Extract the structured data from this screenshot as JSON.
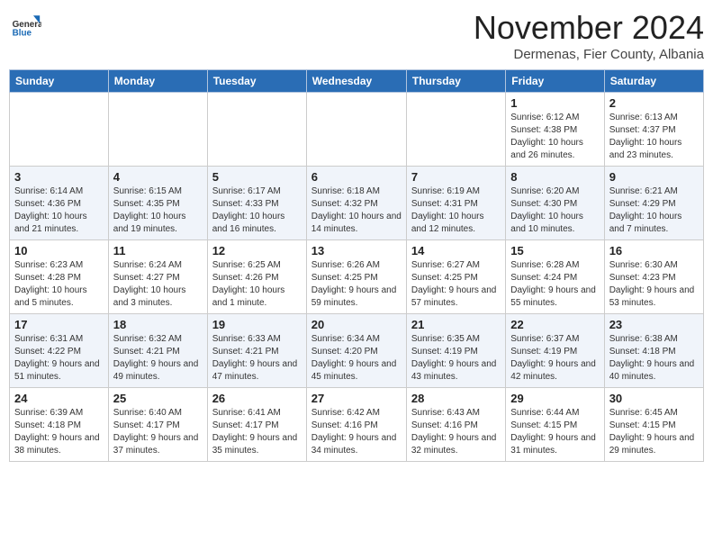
{
  "header": {
    "logo_line1": "General",
    "logo_line2": "Blue",
    "month": "November 2024",
    "location": "Dermenas, Fier County, Albania"
  },
  "weekdays": [
    "Sunday",
    "Monday",
    "Tuesday",
    "Wednesday",
    "Thursday",
    "Friday",
    "Saturday"
  ],
  "weeks": [
    [
      {
        "day": "",
        "info": ""
      },
      {
        "day": "",
        "info": ""
      },
      {
        "day": "",
        "info": ""
      },
      {
        "day": "",
        "info": ""
      },
      {
        "day": "",
        "info": ""
      },
      {
        "day": "1",
        "info": "Sunrise: 6:12 AM\nSunset: 4:38 PM\nDaylight: 10 hours and 26 minutes."
      },
      {
        "day": "2",
        "info": "Sunrise: 6:13 AM\nSunset: 4:37 PM\nDaylight: 10 hours and 23 minutes."
      }
    ],
    [
      {
        "day": "3",
        "info": "Sunrise: 6:14 AM\nSunset: 4:36 PM\nDaylight: 10 hours and 21 minutes."
      },
      {
        "day": "4",
        "info": "Sunrise: 6:15 AM\nSunset: 4:35 PM\nDaylight: 10 hours and 19 minutes."
      },
      {
        "day": "5",
        "info": "Sunrise: 6:17 AM\nSunset: 4:33 PM\nDaylight: 10 hours and 16 minutes."
      },
      {
        "day": "6",
        "info": "Sunrise: 6:18 AM\nSunset: 4:32 PM\nDaylight: 10 hours and 14 minutes."
      },
      {
        "day": "7",
        "info": "Sunrise: 6:19 AM\nSunset: 4:31 PM\nDaylight: 10 hours and 12 minutes."
      },
      {
        "day": "8",
        "info": "Sunrise: 6:20 AM\nSunset: 4:30 PM\nDaylight: 10 hours and 10 minutes."
      },
      {
        "day": "9",
        "info": "Sunrise: 6:21 AM\nSunset: 4:29 PM\nDaylight: 10 hours and 7 minutes."
      }
    ],
    [
      {
        "day": "10",
        "info": "Sunrise: 6:23 AM\nSunset: 4:28 PM\nDaylight: 10 hours and 5 minutes."
      },
      {
        "day": "11",
        "info": "Sunrise: 6:24 AM\nSunset: 4:27 PM\nDaylight: 10 hours and 3 minutes."
      },
      {
        "day": "12",
        "info": "Sunrise: 6:25 AM\nSunset: 4:26 PM\nDaylight: 10 hours and 1 minute."
      },
      {
        "day": "13",
        "info": "Sunrise: 6:26 AM\nSunset: 4:25 PM\nDaylight: 9 hours and 59 minutes."
      },
      {
        "day": "14",
        "info": "Sunrise: 6:27 AM\nSunset: 4:25 PM\nDaylight: 9 hours and 57 minutes."
      },
      {
        "day": "15",
        "info": "Sunrise: 6:28 AM\nSunset: 4:24 PM\nDaylight: 9 hours and 55 minutes."
      },
      {
        "day": "16",
        "info": "Sunrise: 6:30 AM\nSunset: 4:23 PM\nDaylight: 9 hours and 53 minutes."
      }
    ],
    [
      {
        "day": "17",
        "info": "Sunrise: 6:31 AM\nSunset: 4:22 PM\nDaylight: 9 hours and 51 minutes."
      },
      {
        "day": "18",
        "info": "Sunrise: 6:32 AM\nSunset: 4:21 PM\nDaylight: 9 hours and 49 minutes."
      },
      {
        "day": "19",
        "info": "Sunrise: 6:33 AM\nSunset: 4:21 PM\nDaylight: 9 hours and 47 minutes."
      },
      {
        "day": "20",
        "info": "Sunrise: 6:34 AM\nSunset: 4:20 PM\nDaylight: 9 hours and 45 minutes."
      },
      {
        "day": "21",
        "info": "Sunrise: 6:35 AM\nSunset: 4:19 PM\nDaylight: 9 hours and 43 minutes."
      },
      {
        "day": "22",
        "info": "Sunrise: 6:37 AM\nSunset: 4:19 PM\nDaylight: 9 hours and 42 minutes."
      },
      {
        "day": "23",
        "info": "Sunrise: 6:38 AM\nSunset: 4:18 PM\nDaylight: 9 hours and 40 minutes."
      }
    ],
    [
      {
        "day": "24",
        "info": "Sunrise: 6:39 AM\nSunset: 4:18 PM\nDaylight: 9 hours and 38 minutes."
      },
      {
        "day": "25",
        "info": "Sunrise: 6:40 AM\nSunset: 4:17 PM\nDaylight: 9 hours and 37 minutes."
      },
      {
        "day": "26",
        "info": "Sunrise: 6:41 AM\nSunset: 4:17 PM\nDaylight: 9 hours and 35 minutes."
      },
      {
        "day": "27",
        "info": "Sunrise: 6:42 AM\nSunset: 4:16 PM\nDaylight: 9 hours and 34 minutes."
      },
      {
        "day": "28",
        "info": "Sunrise: 6:43 AM\nSunset: 4:16 PM\nDaylight: 9 hours and 32 minutes."
      },
      {
        "day": "29",
        "info": "Sunrise: 6:44 AM\nSunset: 4:15 PM\nDaylight: 9 hours and 31 minutes."
      },
      {
        "day": "30",
        "info": "Sunrise: 6:45 AM\nSunset: 4:15 PM\nDaylight: 9 hours and 29 minutes."
      }
    ]
  ]
}
